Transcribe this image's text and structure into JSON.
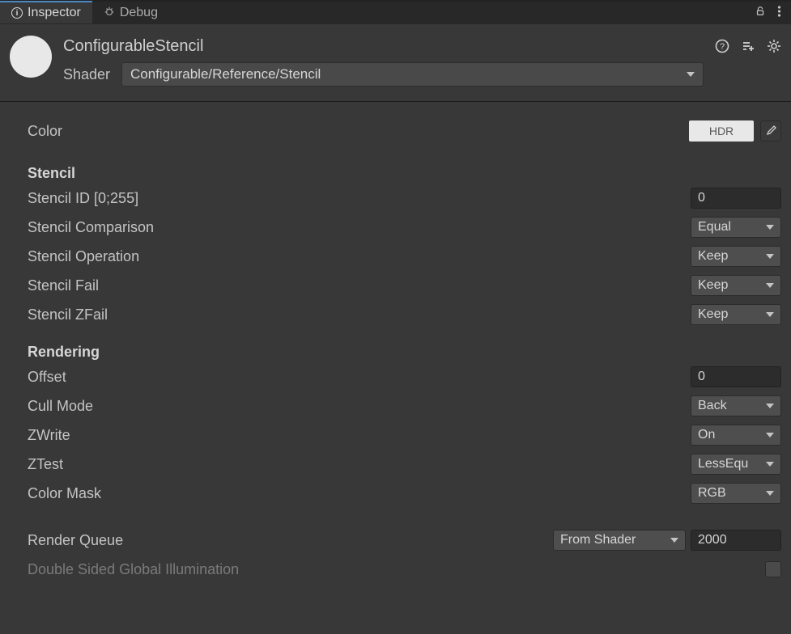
{
  "tabs": {
    "inspector": "Inspector",
    "debug": "Debug"
  },
  "header": {
    "material_name": "ConfigurableStencil",
    "shader_label": "Shader",
    "shader_value": "Configurable/Reference/Stencil"
  },
  "color_row": {
    "label": "Color",
    "badge": "HDR"
  },
  "stencil": {
    "heading": "Stencil",
    "id_label": "Stencil ID [0;255]",
    "id_value": "0",
    "comparison_label": "Stencil Comparison",
    "comparison_value": "Equal",
    "operation_label": "Stencil Operation",
    "operation_value": "Keep",
    "fail_label": "Stencil Fail",
    "fail_value": "Keep",
    "zfail_label": "Stencil ZFail",
    "zfail_value": "Keep"
  },
  "rendering": {
    "heading": "Rendering",
    "offset_label": "Offset",
    "offset_value": "0",
    "cull_label": "Cull Mode",
    "cull_value": "Back",
    "zwrite_label": "ZWrite",
    "zwrite_value": "On",
    "ztest_label": "ZTest",
    "ztest_value": "LessEqu",
    "colormask_label": "Color Mask",
    "colormask_value": "RGB"
  },
  "render_queue": {
    "label": "Render Queue",
    "mode": "From Shader",
    "value": "2000"
  },
  "double_sided_gi": {
    "label": "Double Sided Global Illumination"
  }
}
